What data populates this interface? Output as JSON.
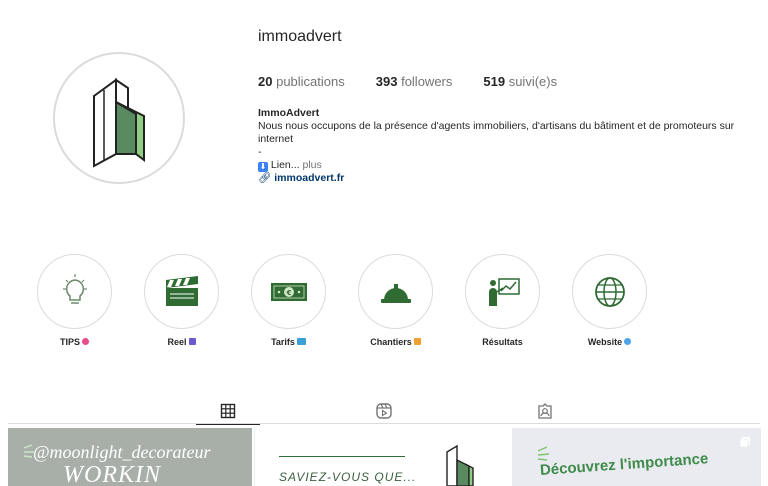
{
  "profile": {
    "username": "immoadvert",
    "posts_count": "20",
    "posts_label": "publications",
    "followers_count": "393",
    "followers_label": "followers",
    "following_count": "519",
    "following_label": "suivi(e)s",
    "display_name": "ImmoAdvert",
    "bio_line1": "Nous nous occupons de la présence d'agents immobiliers, d'artisans du bâtiment et de promoteurs sur internet",
    "bio_dash": "-",
    "bio_link_text": "Lien...",
    "bio_more": "plus",
    "website": "immoadvert.fr"
  },
  "highlights": [
    {
      "label": "TIPS",
      "icon": "lightbulb-icon"
    },
    {
      "label": "Reel",
      "icon": "clapperboard-icon"
    },
    {
      "label": "Tarifs",
      "icon": "banknote-icon"
    },
    {
      "label": "Chantiers",
      "icon": "hardhat-icon"
    },
    {
      "label": "Résultats",
      "icon": "presentation-icon"
    },
    {
      "label": "Website",
      "icon": "globe-icon"
    }
  ],
  "tabs": [
    "grid-icon",
    "reels-icon",
    "tagged-icon"
  ],
  "posts": {
    "p1_handle": "@moonlight_decorateur",
    "p1_big": "WORKIN",
    "p2_text": "SAVIEZ-VOUS QUE...",
    "p3_text": "Découvrez l'importance"
  },
  "colors": {
    "brand_green": "#5a8a5f",
    "brand_light_green": "#8fce83",
    "link": "#00376b"
  }
}
